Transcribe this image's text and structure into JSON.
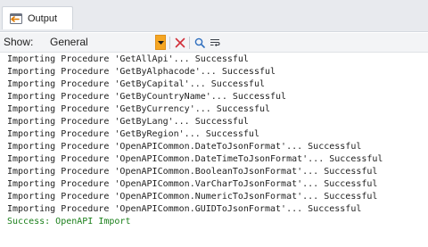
{
  "panel": {
    "tab_label": "Output",
    "tab_icon": "output-window-icon"
  },
  "toolbar": {
    "show_label": "Show:",
    "show_value": "General",
    "dropdown_icon": "chevron-down-icon",
    "clear_icon": "clear-x-icon",
    "find_icon": "search-icon",
    "wrap_icon": "word-wrap-icon",
    "colors": {
      "dropdown_accent": "#f5a623",
      "clear_icon": "#d2303a",
      "find_icon": "#2f6fbf"
    }
  },
  "output": {
    "lines": [
      "Importing Procedure 'GetAllApi'... Successful",
      "Importing Procedure 'GetByAlphacode'... Successful",
      "Importing Procedure 'GetByCapital'... Successful",
      "Importing Procedure 'GetByCountryName'... Successful",
      "Importing Procedure 'GetByCurrency'... Successful",
      "Importing Procedure 'GetByLang'... Successful",
      "Importing Procedure 'GetByRegion'... Successful",
      "Importing Procedure 'OpenAPICommon.DateToJsonFormat'... Successful",
      "Importing Procedure 'OpenAPICommon.DateTimeToJsonFormat'... Successful",
      "Importing Procedure 'OpenAPICommon.BooleanToJsonFormat'... Successful",
      "Importing Procedure 'OpenAPICommon.VarCharToJsonFormat'... Successful",
      "Importing Procedure 'OpenAPICommon.NumericToJsonFormat'... Successful",
      "Importing Procedure 'OpenAPICommon.GUIDToJsonFormat'... Successful"
    ],
    "final_line": "Success: OpenAPI Import",
    "colors": {
      "text": "#1e1e1e",
      "success": "#1a7f1a"
    }
  }
}
